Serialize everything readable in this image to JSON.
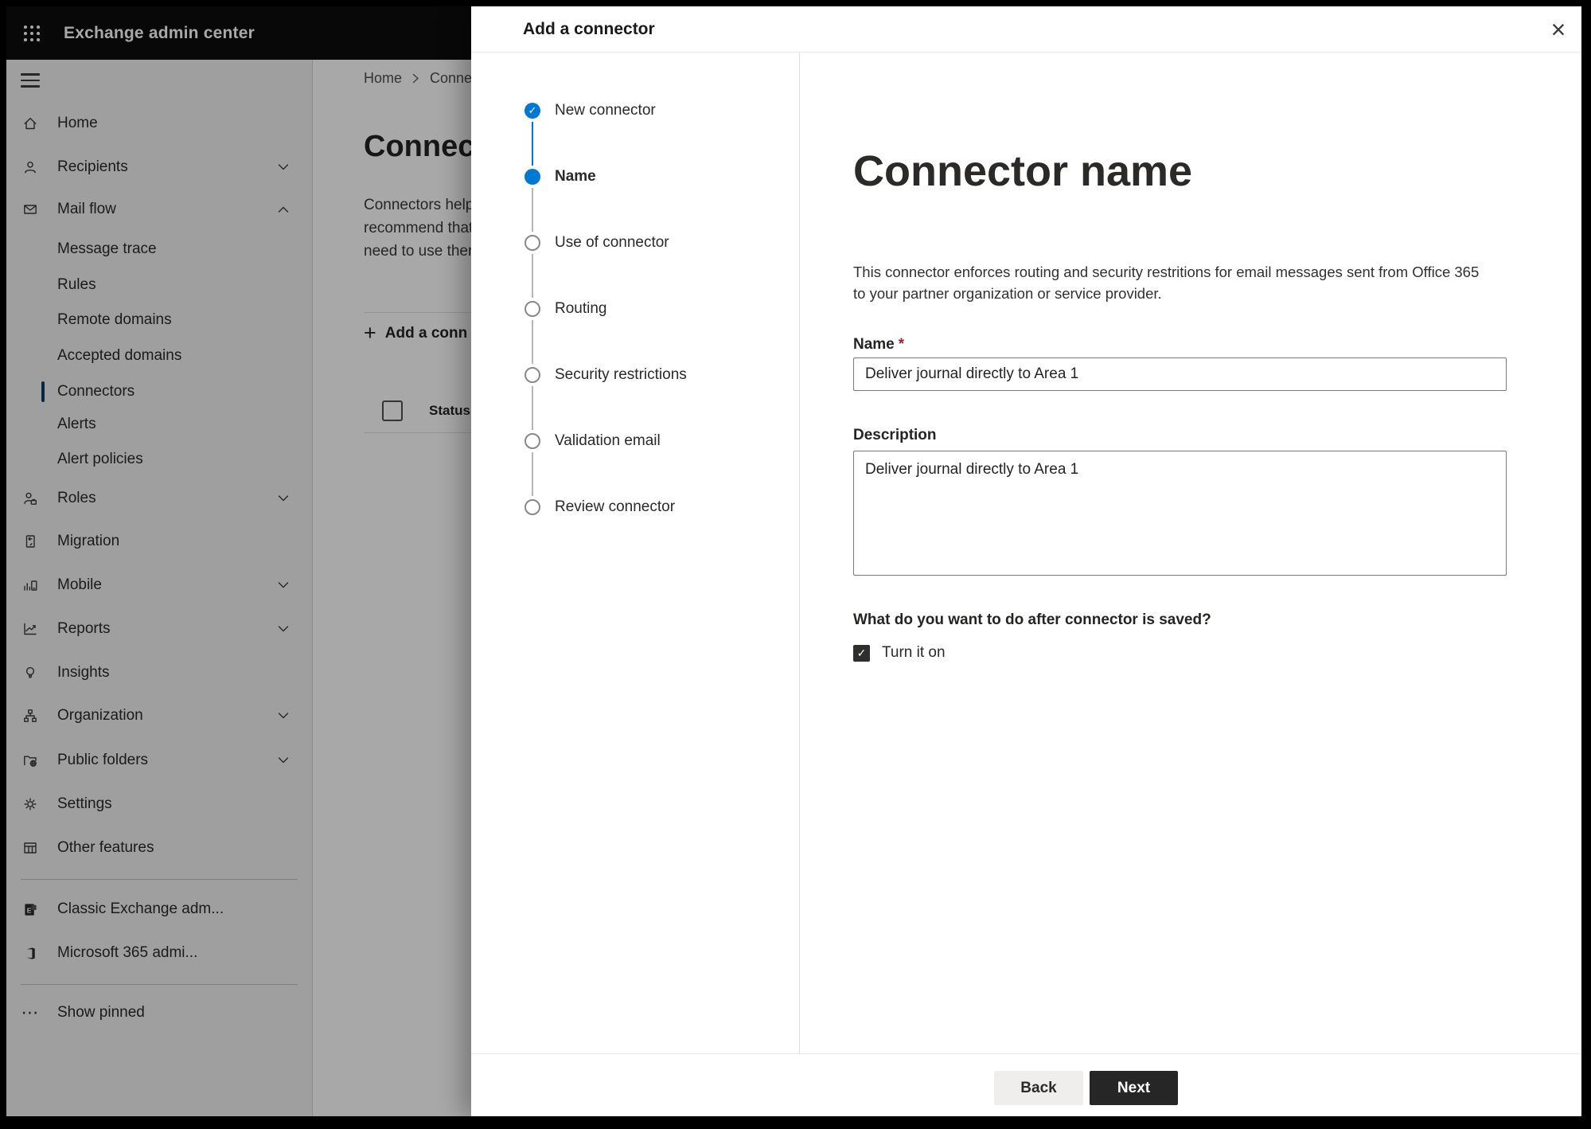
{
  "header": {
    "app_title": "Exchange admin center"
  },
  "sidebar": {
    "items": [
      {
        "label": "Home"
      },
      {
        "label": "Recipients"
      },
      {
        "label": "Mail flow"
      },
      {
        "label": "Message trace"
      },
      {
        "label": "Rules"
      },
      {
        "label": "Remote domains"
      },
      {
        "label": "Accepted domains"
      },
      {
        "label": "Connectors",
        "selected": true
      },
      {
        "label": "Alerts"
      },
      {
        "label": "Alert policies"
      },
      {
        "label": "Roles"
      },
      {
        "label": "Migration"
      },
      {
        "label": "Mobile"
      },
      {
        "label": "Reports"
      },
      {
        "label": "Insights"
      },
      {
        "label": "Organization"
      },
      {
        "label": "Public folders"
      },
      {
        "label": "Settings"
      },
      {
        "label": "Other features"
      },
      {
        "label": "Classic Exchange adm..."
      },
      {
        "label": "Microsoft 365 admi..."
      },
      {
        "label": "Show pinned"
      }
    ]
  },
  "page": {
    "breadcrumb_home": "Home",
    "breadcrumb_current": "Conne",
    "title": "Connec",
    "intro_line1": "Connectors help",
    "intro_line2": "recommend that",
    "intro_line3": "need to use ther",
    "add_button_label": "Add a conn",
    "status_header": "Status"
  },
  "dialog": {
    "title": "Add a connector",
    "steps": [
      {
        "label": "New connector",
        "state": "completed"
      },
      {
        "label": "Name",
        "state": "active"
      },
      {
        "label": "Use of connector",
        "state": "upcoming"
      },
      {
        "label": "Routing",
        "state": "upcoming"
      },
      {
        "label": "Security restrictions",
        "state": "upcoming"
      },
      {
        "label": "Validation email",
        "state": "upcoming"
      },
      {
        "label": "Review connector",
        "state": "upcoming"
      }
    ],
    "content": {
      "heading": "Connector name",
      "description_line1": "This connector enforces routing and security restritions for email messages sent from Office 365",
      "description_line2": "to your partner organization or service provider.",
      "name_label": "Name",
      "required_mark": "*",
      "name_value": "Deliver journal directly to Area 1",
      "description_label": "Description",
      "description_value": "Deliver journal directly to Area 1",
      "after_save_question": "What do you want to do after connector is saved?",
      "turn_on_label": "Turn it on",
      "turn_on_checked": true
    },
    "footer": {
      "back_label": "Back",
      "next_label": "Next"
    }
  },
  "icons": {
    "check": "✓",
    "close": "×",
    "plus": "+",
    "ellipsis": "⋯"
  },
  "colors": {
    "accent": "#0078d4",
    "required": "#a4262c",
    "next_button_bg": "#262626"
  }
}
